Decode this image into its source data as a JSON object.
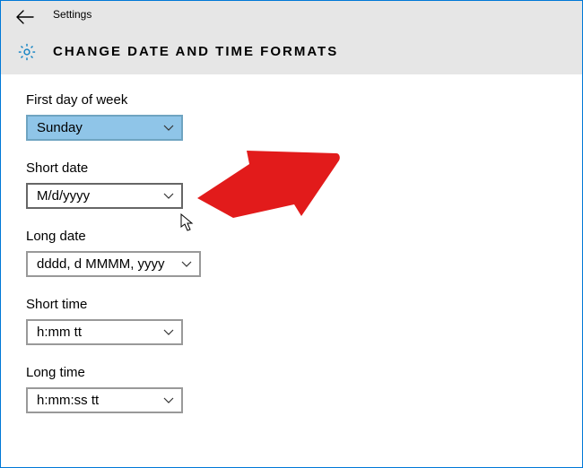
{
  "window": {
    "title": "Settings"
  },
  "page": {
    "heading": "CHANGE DATE AND TIME FORMATS"
  },
  "fields": {
    "fdow": {
      "label": "First day of week",
      "value": "Sunday"
    },
    "sdate": {
      "label": "Short date",
      "value": "M/d/yyyy"
    },
    "ldate": {
      "label": "Long date",
      "value": "dddd, d MMMM, yyyy"
    },
    "stime": {
      "label": "Short time",
      "value": "h:mm tt"
    },
    "ltime": {
      "label": "Long time",
      "value": "h:mm:ss tt"
    }
  }
}
